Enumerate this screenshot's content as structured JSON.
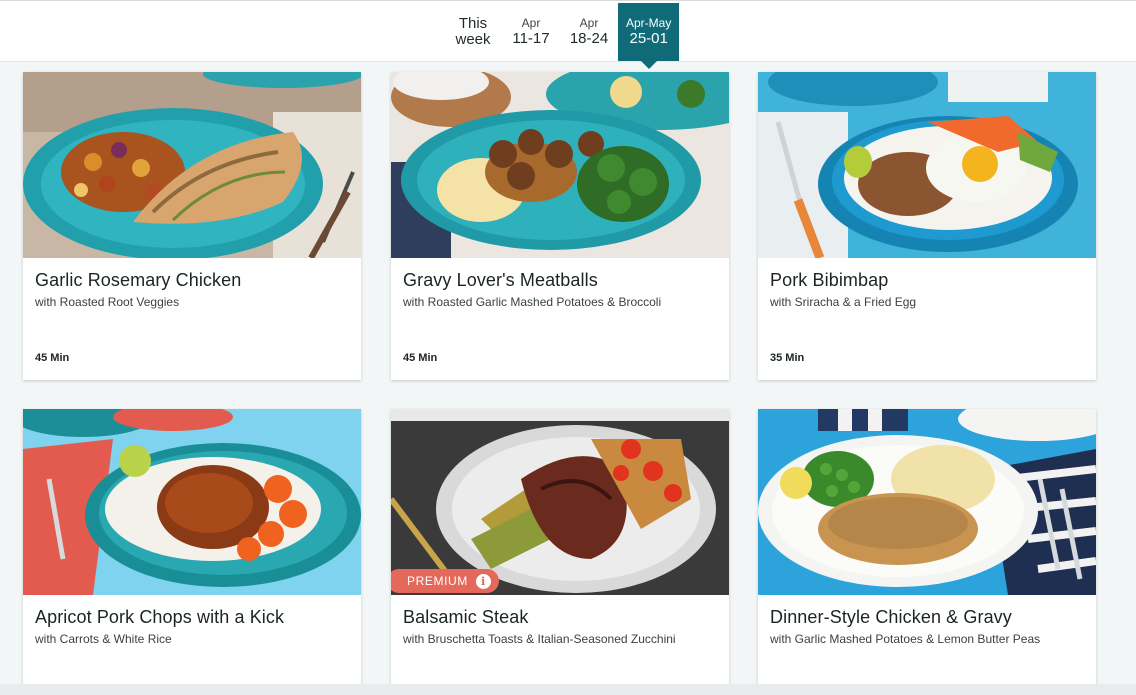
{
  "week_tabs": [
    {
      "line1": "This",
      "line2": "week",
      "active": false
    },
    {
      "line1": "Apr",
      "line2": "11-17",
      "active": false
    },
    {
      "line1": "Apr",
      "line2": "18-24",
      "active": false
    },
    {
      "line1": "Apr-May",
      "line2": "25-01",
      "active": true
    }
  ],
  "colors": {
    "accent": "#0e6b77",
    "premium": "#e4695a"
  },
  "meals": [
    {
      "title": "Garlic Rosemary Chicken",
      "subtitle": "with Roasted Root Veggies",
      "time": "45 Min"
    },
    {
      "title": "Gravy Lover's Meatballs",
      "subtitle": "with Roasted Garlic Mashed Potatoes & Broccoli",
      "time": "45 Min"
    },
    {
      "title": "Pork Bibimbap",
      "subtitle": "with Sriracha & a Fried Egg",
      "time": "35 Min"
    },
    {
      "title": "Apricot Pork Chops with a Kick",
      "subtitle": "with Carrots & White Rice",
      "time": ""
    },
    {
      "title": "Balsamic Steak",
      "subtitle": "with Bruschetta Toasts & Italian-Seasoned Zucchini",
      "time": "",
      "badge": "PREMIUM"
    },
    {
      "title": "Dinner-Style Chicken & Gravy",
      "subtitle": "with Garlic Mashed Potatoes & Lemon Butter Peas",
      "time": ""
    }
  ]
}
